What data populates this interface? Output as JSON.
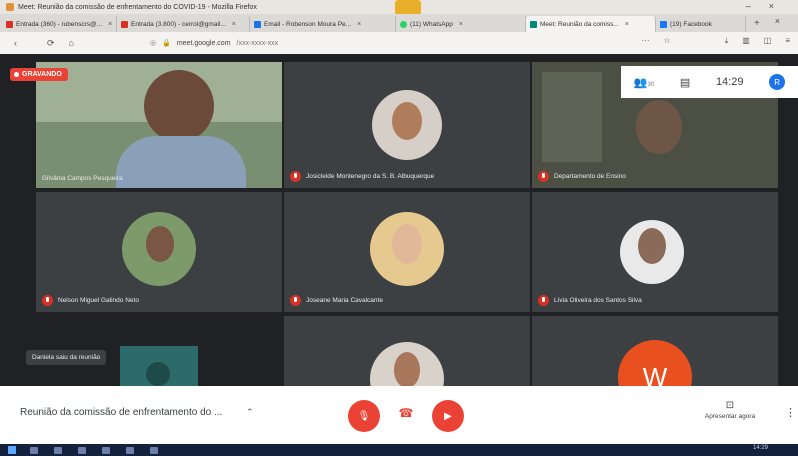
{
  "browser": {
    "window_title": "Meet: Reunião da comissão de enfrentamento do COVID-19 - Mozilla Firefox",
    "tabs": [
      {
        "label": "Entrada (360) - rubenscrs@...",
        "color": "#d93025"
      },
      {
        "label": "Entrada (3.800) - cerrol@gmail...",
        "color": "#d93025"
      },
      {
        "label": "Email - Robenson Moura Pe...",
        "color": "#1a73e8"
      },
      {
        "label": "(11) WhatsApp",
        "color": "#25d366"
      },
      {
        "label": "Meet: Reunião da comiss...",
        "color": "#00897b"
      },
      {
        "label": "(19) Facebook",
        "color": "#1877f2"
      }
    ],
    "url_host": "meet.google.com",
    "url_rest": "/xxx-xxxx-xxx",
    "new_tab": "+",
    "close": "×"
  },
  "meet": {
    "recording_label": "GRAVANDO",
    "participant_count": "30",
    "clock": "14:29",
    "account_initial": "R",
    "toast": "Daniela saiu da reunião",
    "participants": [
      {
        "name": "Gilvânia Campos Pesqueira"
      },
      {
        "name": "Josicleide Montenegro da S. B. Albuquerque"
      },
      {
        "name": "Departamento de Ensino"
      },
      {
        "name": "Nelson Miguel Galindo Neto"
      },
      {
        "name": "Joseane Maria Cavalcante"
      },
      {
        "name": "Lívia Oliveira dos Santos Silva"
      }
    ],
    "bottom_initial": "W"
  },
  "controls": {
    "meeting_title": "Reunião da comissão de enfrentamento do ...",
    "present_label": "Apresentar agora",
    "more": "⋮"
  },
  "colors": {
    "accent_red": "#ea4335",
    "meet_bg": "#202124",
    "tile_bg": "#3c4043"
  }
}
